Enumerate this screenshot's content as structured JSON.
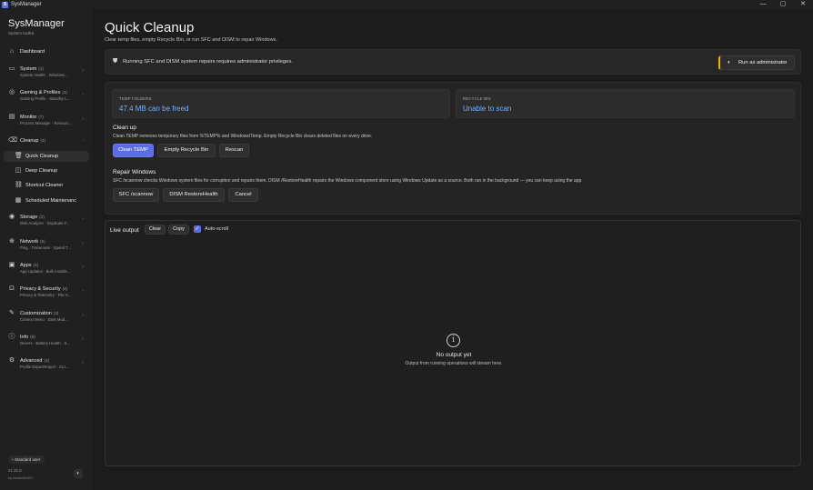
{
  "window": {
    "title": "SysManager",
    "app_icon": "S",
    "controls": {
      "minimize": "—",
      "maximize": "▢",
      "close": "✕"
    }
  },
  "sidebar": {
    "brand": "SysManager",
    "brand_sub": "System toolkit",
    "dashboard": {
      "label": "Dashboard",
      "icon": "home-icon"
    },
    "groups": [
      {
        "label": "System",
        "count": "(1)",
        "sub": "System Health · Windows...",
        "icon": "monitor-icon"
      },
      {
        "label": "Gaming & Profiles",
        "count": "(3)",
        "sub": "Gaming Profile · Standby L...",
        "icon": "gamepad-icon"
      },
      {
        "label": "Monitor",
        "count": "(7)",
        "sub": "Process Manager · Resourc...",
        "icon": "chart-icon"
      },
      {
        "label": "Cleanup",
        "count": "(4)",
        "sub": "",
        "icon": "broom-icon"
      }
    ],
    "cleanup_items": [
      {
        "label": "Quick Cleanup",
        "icon": "trash-icon"
      },
      {
        "label": "Deep Cleanup",
        "icon": "layers-icon"
      },
      {
        "label": "Shortcut Cleaner",
        "icon": "link-icon"
      },
      {
        "label": "Scheduled Maintenanc",
        "icon": "calendar-icon"
      }
    ],
    "groups_after": [
      {
        "label": "Storage",
        "count": "(2)",
        "sub": "Disk Analyzer · Duplicate F...",
        "icon": "disk-icon"
      },
      {
        "label": "Network",
        "count": "(5)",
        "sub": "Ping · Traceroute · Speed T...",
        "icon": "globe-icon"
      },
      {
        "label": "Apps",
        "count": "(3)",
        "sub": "App Updates · Bulk Installe...",
        "icon": "apps-icon"
      },
      {
        "label": "Privacy & Security",
        "count": "(4)",
        "sub": "Privacy & Telemetry · File S...",
        "icon": "lock-icon"
      },
      {
        "label": "Customization",
        "count": "(3)",
        "sub": "Context Menu · Dark Mod...",
        "icon": "brush-icon"
      },
      {
        "label": "Info",
        "count": "(8)",
        "sub": "Drivers · Battery Health · S...",
        "icon": "info-icon"
      },
      {
        "label": "Advanced",
        "count": "(3)",
        "sub": "Profile Export/Import · CLI...",
        "icon": "gear-icon"
      }
    ],
    "footer": {
      "user": "Standard user",
      "version": "v1.31.6",
      "author": "by laurentiu021"
    }
  },
  "main": {
    "title": "Quick Cleanup",
    "subtitle": "Clear temp files, empty Recycle Bin, or run SFC and DISM to repair Windows.",
    "admin_notice": "Running SFC and DISM system repairs requires administrator privileges.",
    "admin_button": "Run as administrator",
    "stats": {
      "temp_label": "TEMP FOLDERS",
      "temp_value": "47.4 MB can be freed",
      "bin_label": "RECYCLE BIN",
      "bin_value": "Unable to scan"
    },
    "cleanup": {
      "title": "Clean up",
      "desc": "Clean TEMP removes temporary files from %TEMP% and Windows\\Temp. Empty Recycle Bin clears deleted files on every drive.",
      "buttons": [
        "Clean TEMP",
        "Empty Recycle Bin",
        "Rescan"
      ]
    },
    "repair": {
      "title": "Repair Windows",
      "desc": "SFC /scannow checks Windows system files for corruption and repairs them. DISM /RestoreHealth repairs the Windows component store using Windows Update as a source. Both run in the background — you can keep using the app.",
      "buttons": [
        "SFC /scannow",
        "DISM RestoreHealth",
        "Cancel"
      ]
    },
    "output": {
      "title": "Live output",
      "clear": "Clear",
      "copy": "Copy",
      "autoscroll": "Auto-scroll",
      "autoscroll_checked": true,
      "empty_title": "No output yet",
      "empty_sub": "Output from running operations will stream here."
    }
  },
  "colors": {
    "accent": "#5b6ee1",
    "stat_value": "#6fb3ff",
    "admin_marker": "#e6b800"
  }
}
